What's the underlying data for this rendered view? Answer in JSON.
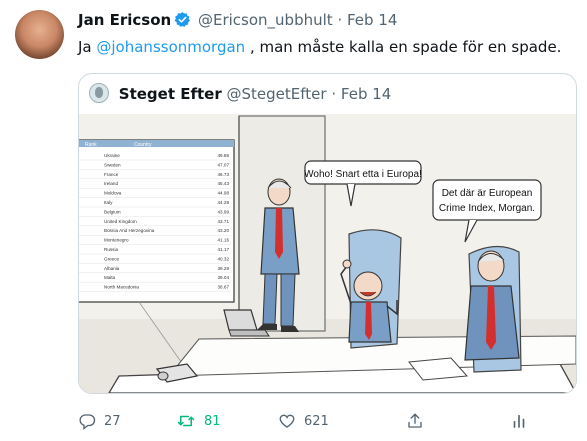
{
  "tweet": {
    "author_name": "Jan Ericson",
    "author_handle": "@Ericson_ubbhult",
    "separator": "·",
    "date": "Feb 14",
    "text_prefix": "Ja ",
    "mention": "@johanssonmorgan",
    "text_suffix": " , man måste kalla en spade för en spade."
  },
  "quote": {
    "author_name": "Steget Efter",
    "author_handle": "@StegetEfter",
    "separator": "·",
    "date": "Feb 14",
    "cartoon": {
      "speech_bubble_left": "Woho! Snart etta i Europa!",
      "speech_bubble_right_line1": "Det där är European",
      "speech_bubble_right_line2": "Crime Index, Morgan.",
      "screen_header_rank": "Rank",
      "screen_header_country": "Country",
      "screen_rows": [
        {
          "country": "Ukraine",
          "value": "49.85"
        },
        {
          "country": "Sweden",
          "value": "47.07"
        },
        {
          "country": "France",
          "value": "46.73"
        },
        {
          "country": "Ireland",
          "value": "45.43"
        },
        {
          "country": "Moldova",
          "value": "44.98"
        },
        {
          "country": "Italy",
          "value": "44.28"
        },
        {
          "country": "Belgium",
          "value": "43.99"
        },
        {
          "country": "United Kingdom",
          "value": "43.71"
        },
        {
          "country": "Bosnia And Herzegovina",
          "value": "43.20"
        },
        {
          "country": "Montenegro",
          "value": "41.16"
        },
        {
          "country": "Russia",
          "value": "41.17"
        },
        {
          "country": "Greece",
          "value": "40.32"
        },
        {
          "country": "Albania",
          "value": "39.29"
        },
        {
          "country": "Malta",
          "value": "39.04"
        },
        {
          "country": "North Macedonia",
          "value": "38.67"
        }
      ]
    }
  },
  "actions": {
    "reply_count": "27",
    "retweet_count": "81",
    "like_count": "621"
  },
  "colors": {
    "accent": "#1d9bf0",
    "retweet_active": "#00ba7c",
    "muted": "#536471"
  }
}
